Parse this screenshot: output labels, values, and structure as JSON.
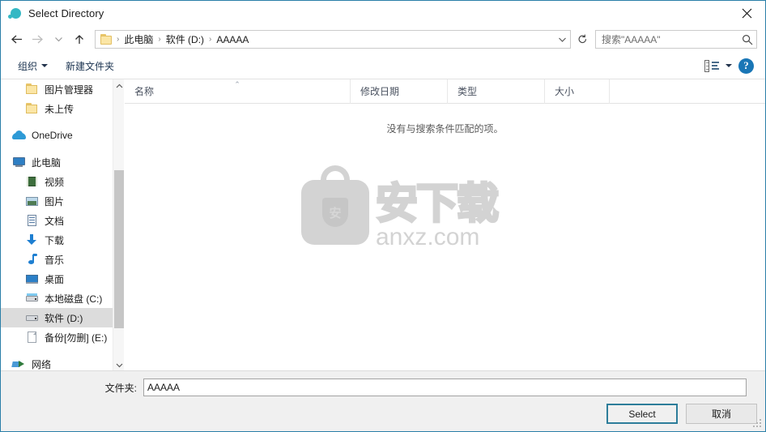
{
  "window": {
    "title": "Select Directory",
    "app_icon": "teal-circle-icon",
    "close_label": "close-icon",
    "accent_color": "#2d7d9a",
    "icon_color": "#35b8c4"
  },
  "nav": {
    "back": "back-arrow",
    "forward": "forward-arrow",
    "recent": "recent-chevron",
    "up": "up-arrow",
    "refresh": "refresh-icon",
    "address_chevron": "chevron-down-icon",
    "breadcrumbs": [
      {
        "label": "此电脑"
      },
      {
        "label": "软件 (D:)"
      },
      {
        "label": "AAAAA"
      }
    ],
    "separator": "›"
  },
  "search": {
    "placeholder": "搜索\"AAAAA\"",
    "icon": "search-icon"
  },
  "toolbar": {
    "organize_label": "组织",
    "new_folder_label": "新建文件夹",
    "view_icon": "list-view-icon",
    "view_caret": "chevron-down-icon",
    "help_label": "?"
  },
  "sidebar": {
    "items": [
      {
        "label": "图片管理器",
        "icon": "folder-icon",
        "indent": 1,
        "selected": false
      },
      {
        "label": "未上传",
        "icon": "folder-icon",
        "indent": 1,
        "selected": false
      },
      {
        "label": "OneDrive",
        "icon": "onedrive-cloud-icon",
        "indent": 0,
        "selected": false
      },
      {
        "label": "此电脑",
        "icon": "this-pc-icon",
        "indent": 0,
        "selected": false
      },
      {
        "label": "视频",
        "icon": "videos-icon",
        "indent": 1,
        "selected": false
      },
      {
        "label": "图片",
        "icon": "pictures-icon",
        "indent": 1,
        "selected": false
      },
      {
        "label": "文档",
        "icon": "documents-icon",
        "indent": 1,
        "selected": false
      },
      {
        "label": "下载",
        "icon": "downloads-icon",
        "indent": 1,
        "selected": false
      },
      {
        "label": "音乐",
        "icon": "music-icon",
        "indent": 1,
        "selected": false
      },
      {
        "label": "桌面",
        "icon": "desktop-icon",
        "indent": 1,
        "selected": false
      },
      {
        "label": "本地磁盘 (C:)",
        "icon": "system-drive-icon",
        "indent": 1,
        "selected": false
      },
      {
        "label": "软件 (D:)",
        "icon": "drive-icon",
        "indent": 1,
        "selected": true
      },
      {
        "label": "备份[勿删] (E:)",
        "icon": "file-drive-icon",
        "indent": 1,
        "selected": false
      },
      {
        "label": "网络",
        "icon": "network-icon",
        "indent": 0,
        "selected": false
      }
    ],
    "scroll_up": "scroll-up-arrow",
    "scroll_down": "scroll-down-arrow"
  },
  "filelist": {
    "columns": [
      {
        "label": "名称",
        "sorted": true,
        "sort_caret": "⌃"
      },
      {
        "label": "修改日期",
        "sorted": false
      },
      {
        "label": "类型",
        "sorted": false
      },
      {
        "label": "大小",
        "sorted": false
      }
    ],
    "empty_message": "没有与搜索条件匹配的项。",
    "rows": []
  },
  "watermark": {
    "chinese": "安下载",
    "url": "anxz.com",
    "badge_char": "安"
  },
  "footer": {
    "folder_label": "文件夹:",
    "folder_value": "AAAAA",
    "select_button": "Select",
    "cancel_button": "取消"
  }
}
